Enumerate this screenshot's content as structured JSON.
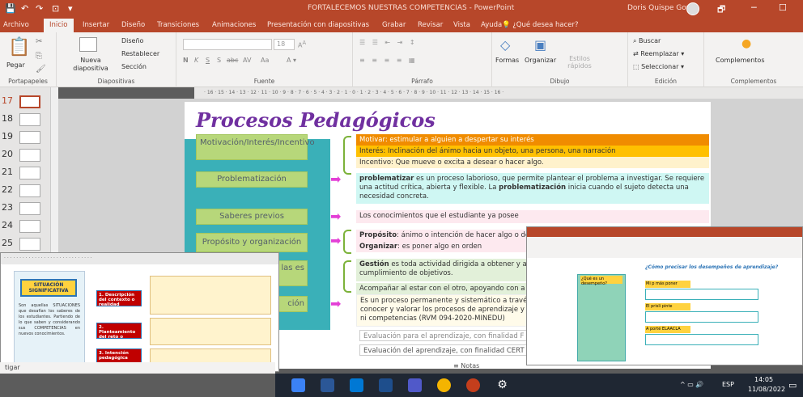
{
  "window": {
    "title": "FORTALECEMOS NUESTRAS COMPETENCIAS - PowerPoint",
    "user": "Doris Quispe Govia",
    "quick_access": [
      "💾",
      "↶",
      "↷",
      "⊡",
      "▾"
    ],
    "controls": [
      "🗗",
      "─",
      "☐"
    ]
  },
  "tabs": [
    "Archivo",
    "Inicio",
    "Insertar",
    "Diseño",
    "Transiciones",
    "Animaciones",
    "Presentación con diapositivas",
    "Grabar",
    "Revisar",
    "Vista",
    "Ayuda"
  ],
  "active_tab": "Inicio",
  "tell_me": "¿Qué desea hacer?",
  "ribbon": {
    "portapapeles": {
      "label": "Portapapeles",
      "paste": "Pegar"
    },
    "diapositivas": {
      "label": "Diapositivas",
      "new_slide": "Nueva diapositiva",
      "layout": "Diseño",
      "reset": "Restablecer",
      "section": "Sección"
    },
    "fuente": {
      "label": "Fuente",
      "bold": "N",
      "italic": "K",
      "underline": "S",
      "shadow": "S",
      "strike": "abc",
      "spacing": "AV",
      "case": "Aa",
      "size": "18"
    },
    "parrafo": {
      "label": "Párrafo"
    },
    "dibujo": {
      "label": "Dibujo",
      "shapes": "Formas",
      "arrange": "Organizar",
      "quick_styles": "Estilos rápidos"
    },
    "edicion": {
      "label": "Edición",
      "search": "Buscar",
      "replace": "Reemplazar",
      "select": "Seleccionar"
    },
    "complementos": {
      "label": "Complementos",
      "button": "Complementos"
    }
  },
  "ruler_text": "· 16 · 15 · 14 · 13 · 12 · 11 · 10 · 9 · 8 · 7 · 6 · 5 · 4 · 3 · 2 · 1 · 0 · 1 · 2 · 3 · 4 · 5 · 6 · 7 · 8 · 9 · 10 · 11 · 12 · 13 · 14 · 15 · 16 ·",
  "thumbnails": [
    {
      "num": "17",
      "selected": true
    },
    {
      "num": "18",
      "selected": false
    },
    {
      "num": "19",
      "selected": false
    },
    {
      "num": "20",
      "selected": false
    },
    {
      "num": "21",
      "selected": false
    },
    {
      "num": "22",
      "selected": false
    },
    {
      "num": "23",
      "selected": false
    },
    {
      "num": "24",
      "selected": false
    },
    {
      "num": "25",
      "selected": false
    }
  ],
  "slide": {
    "title": "Procesos Pedagógicos",
    "processes": [
      "Motivación/Interés/Incentivo",
      "Problematización",
      "Saberes previos",
      "Propósito y organización",
      "Acompañamiento",
      "Evaluación"
    ],
    "partial_labels": {
      "acompanamiento": "ñamiento de las es",
      "evaluacion": "ción"
    },
    "motivation_rows": [
      "Motivar: estimular a alguien a despertar su interés",
      "Interés: Inclinación del ánimo hacia un objeto, una persona, una narración",
      "Incentivo: Que mueve o excita a desear o hacer algo."
    ],
    "problematizacion_bold": "problematizar",
    "problematizacion_text": " es un proceso laborioso, que permite plantear el problema a investigar. Se requiere una actitud crítica, abierta y flexible. La ",
    "problematizacion_bold2": "problematización",
    "problematizacion_text2": " inicia cuando el sujeto detecta una necesidad concreta.",
    "saberes_text": "Los conocimientos que el estudiante ya posee",
    "proposito_bold": "Propósito",
    "proposito_text": ": ánimo o intención de hacer algo o de",
    "organizar_bold": "Organizar",
    "organizar_text": ": es poner algo en orden",
    "gestion_bold": "Gestión",
    "gestion_text": " es toda actividad dirigida a obtener y as cumplimiento de objetivos.",
    "acompanar_text": "Acompañar al estar con el otro, apoyando con a",
    "evaluacion_text": "Es un proceso permanente y sistemático a travé conocer y valorar los procesos de aprendizaje y ni competencias (RVM 094-2020-MINEDU)",
    "eval_para": "Evaluación para el aprendizaje, con finalidad F",
    "eval_del": "Evaluación del aprendizaje, con finalidad CERT"
  },
  "win2": {
    "title": "Situación Significativa",
    "boxes": [
      "SITUACIÓN SIGNIFICATIVA",
      "1. Descripción del contexto o realidad",
      "2. Planteamiento del reto o desafío",
      "3. Intención pedagógica"
    ],
    "left_text": "Son aquellas SITUACIONES que desafían los saberes de los estudiantes. Partiendo de lo que saben y considerando sus COMPETENCIAS en nuevos conocimientos."
  },
  "win3": {
    "heading": "¿Cómo precisar los desempeños de aprendizaje?",
    "left_q": "¿Qué es un desempeño?",
    "labels": [
      "Mi p más poner",
      "El prisli pinte",
      "A porté ELAACLA"
    ]
  },
  "statusbar": {
    "left": "tigar",
    "notes": "Notas"
  },
  "taskbar": {
    "lang": "ESP",
    "time": "14:05",
    "date": "11/08/2022"
  }
}
